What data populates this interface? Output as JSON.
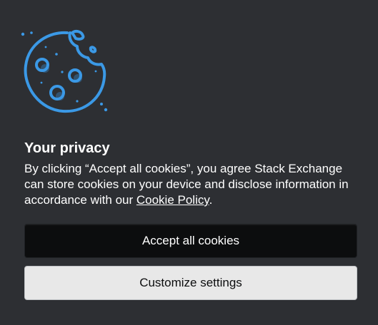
{
  "dialog": {
    "title": "Your privacy",
    "message_before": "By clicking “Accept all cookies”, you agree Stack Exchange can store cookies on your device and disclose information in accordance with our ",
    "link_text": "Cookie Policy",
    "message_after": ".",
    "accept_label": "Accept all cookies",
    "customize_label": "Customize settings",
    "icon": "cookie-icon"
  },
  "colors": {
    "background": "#2d2f33",
    "accent": "#3b99e6",
    "accept_bg": "#0c0d0e",
    "customize_bg": "#e8e8e8"
  }
}
